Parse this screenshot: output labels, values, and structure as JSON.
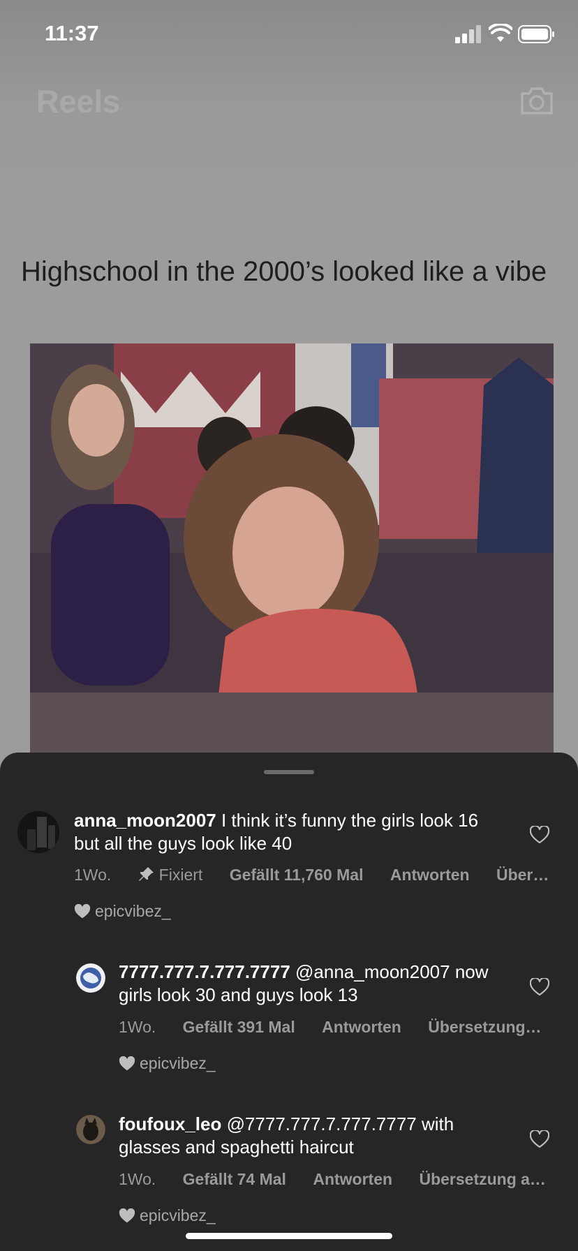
{
  "status": {
    "time": "11:37"
  },
  "header": {
    "title": "Reels"
  },
  "reel": {
    "caption": "Highschool in the 2000’s looked like a vibe"
  },
  "comments": [
    {
      "user": "anna_moon2007",
      "text": "I think it’s funny the girls look 16 but all the guys look like 40",
      "time": "1Wo.",
      "pinned": "Fixiert",
      "likes": "Gefällt 11,760 Mal",
      "reply": "Antworten",
      "translate": "Über…",
      "liked_by": "epicvibez_"
    },
    {
      "user": "7777.777.7.777.7777",
      "text": "@anna_moon2007 now girls look 30 and guys look 13",
      "time": "1Wo.",
      "likes": "Gefällt 391 Mal",
      "reply": "Antworten",
      "translate": "Übersetzung…",
      "liked_by": "epicvibez_"
    },
    {
      "user": "foufoux_leo",
      "text": "@7777.777.7.777.7777 with glasses and spaghetti haircut",
      "time": "1Wo.",
      "likes": "Gefällt 74 Mal",
      "reply": "Antworten",
      "translate": "Übersetzung a…",
      "liked_by": "epicvibez_"
    }
  ],
  "icons": {
    "camera": "camera-icon",
    "heart": "heart-outline-icon",
    "pin": "pin-icon",
    "liked": "heart-filled-icon"
  },
  "colors": {
    "sheet": "#262626",
    "muted": "#9a9a9a",
    "caption": "#1e1e1e"
  }
}
